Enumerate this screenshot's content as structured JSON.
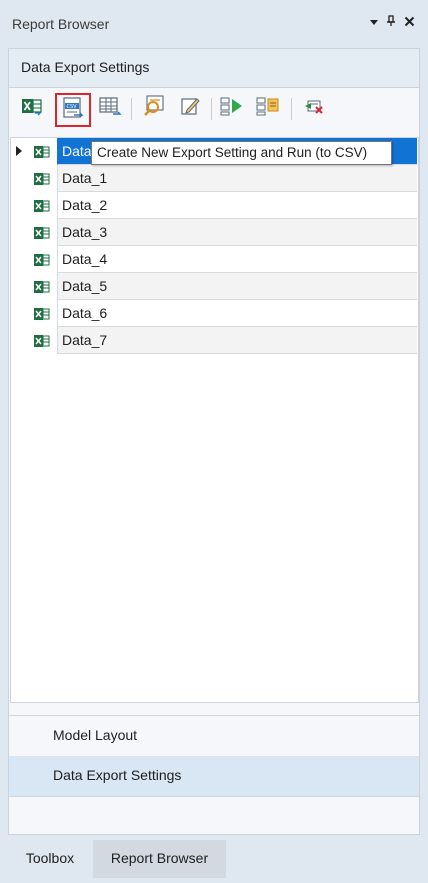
{
  "window": {
    "title": "Report Browser",
    "controls": [
      "dropdown-icon",
      "pin-icon",
      "close-icon"
    ]
  },
  "section": {
    "title": "Data Export Settings"
  },
  "toolbar": {
    "buttons": [
      {
        "name": "new-export-excel-icon",
        "highlighted": false
      },
      {
        "name": "new-export-csv-icon",
        "highlighted": true
      },
      {
        "name": "new-export-table-icon",
        "highlighted": false
      },
      {
        "name": "search-settings-icon",
        "highlighted": false
      },
      {
        "name": "edit-icon",
        "highlighted": false
      },
      {
        "name": "run-export-icon",
        "highlighted": false
      },
      {
        "name": "export-settings-icon",
        "highlighted": false
      },
      {
        "name": "delete-icon",
        "highlighted": false
      }
    ],
    "tooltip": "Create New Export Setting and Run (to CSV)"
  },
  "grid": {
    "rows": [
      {
        "name": "Data",
        "selected": true
      },
      {
        "name": "Data_1",
        "selected": false
      },
      {
        "name": "Data_2",
        "selected": false
      },
      {
        "name": "Data_3",
        "selected": false
      },
      {
        "name": "Data_4",
        "selected": false
      },
      {
        "name": "Data_5",
        "selected": false
      },
      {
        "name": "Data_6",
        "selected": false
      },
      {
        "name": "Data_7",
        "selected": false
      }
    ]
  },
  "nav": {
    "model_layout": "Model Layout",
    "data_export_settings": "Data Export Settings"
  },
  "tabs": {
    "toolbox": "Toolbox",
    "report_browser": "Report Browser"
  },
  "colors": {
    "selection": "#1173d4",
    "highlight_border": "#d9262e",
    "excel_green": "#1d6f42"
  }
}
